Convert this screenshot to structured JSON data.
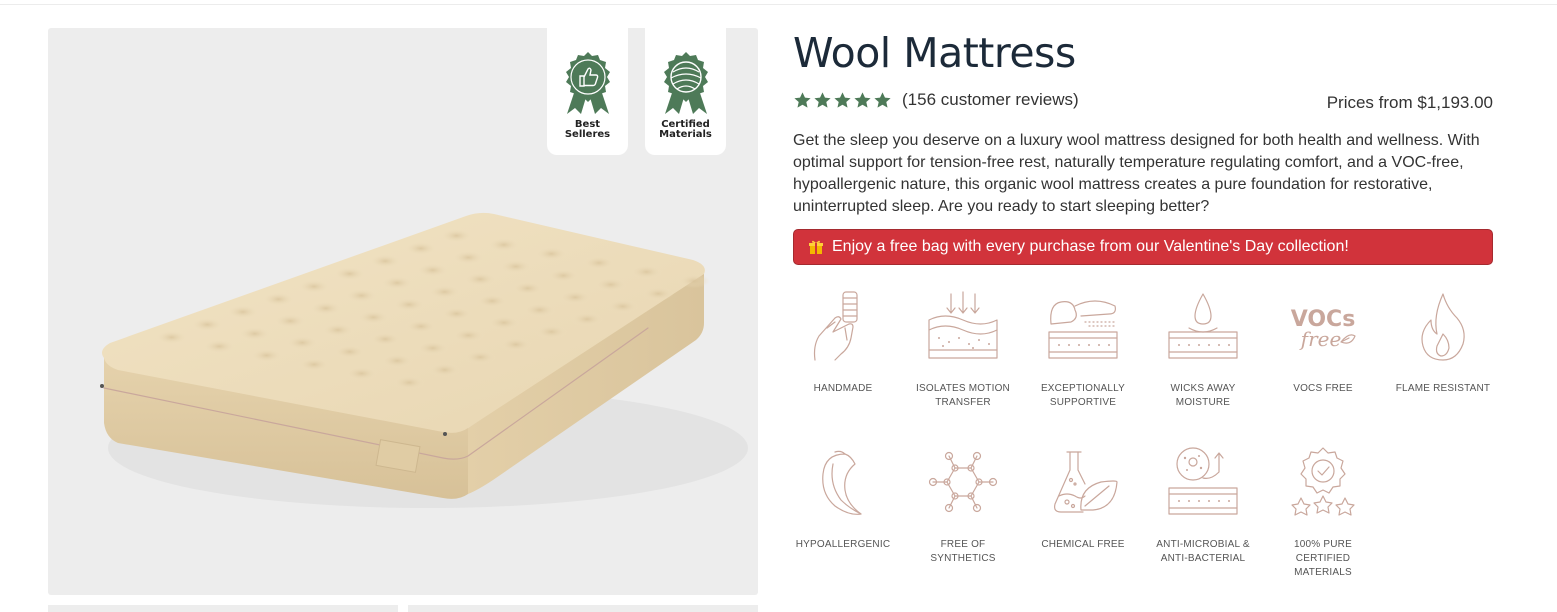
{
  "product": {
    "title": "Wool Mattress",
    "rating_stars": 5,
    "review_count_text": "(156 customer reviews)",
    "price_text": "Prices from $1,193.00",
    "description": "Get the sleep you deserve on a luxury wool mattress designed for both health and wellness. With optimal support for tension-free rest, naturally temperature regulating comfort, and a VOC-free, hypoallergenic nature, this organic wool mattress creates a pure foundation for restorative, uninterrupted sleep. Are you ready to start sleeping better?",
    "promo_text": "Enjoy a free bag with every purchase from our Valentine's Day collection!"
  },
  "badges": [
    {
      "label": "Best Selleres",
      "icon": "thumbs-up-ribbon-icon"
    },
    {
      "label": "Certified Materials",
      "icon": "wool-yarn-ribbon-icon"
    }
  ],
  "features": [
    {
      "label": "HANDMADE",
      "icon": "hand-thread-spool-icon"
    },
    {
      "label": "ISOLATES MOTION TRANSFER",
      "icon": "mattress-arrows-icon"
    },
    {
      "label": "EXCEPTIONALLY SUPPORTIVE",
      "icon": "pillow-mattress-icon"
    },
    {
      "label": "WICKS AWAY MOISTURE",
      "icon": "drop-mattress-icon"
    },
    {
      "label": "VOCS FREE",
      "icon": "vocs-free-icon",
      "icon_text_top": "VOCs",
      "icon_text_bottom": "free"
    },
    {
      "label": "FLAME RESISTANT",
      "icon": "flame-icon"
    },
    {
      "label": "HYPOALLERGENIC",
      "icon": "feather-icon"
    },
    {
      "label": "FREE OF SYNTHETICS",
      "icon": "molecule-icon"
    },
    {
      "label": "CHEMICAL FREE",
      "icon": "flask-leaf-icon"
    },
    {
      "label": "ANTI-MICROBIAL & ANTI-BACTERIAL",
      "icon": "microbe-mattress-icon"
    },
    {
      "label": "100% PURE CERTIFIED MATERIALS",
      "icon": "certified-stars-icon"
    }
  ],
  "colors": {
    "brand_green": "#4e7a58",
    "promo_red": "#d1333b",
    "icon_tan": "#c9a79c",
    "title": "#1c2a39"
  }
}
